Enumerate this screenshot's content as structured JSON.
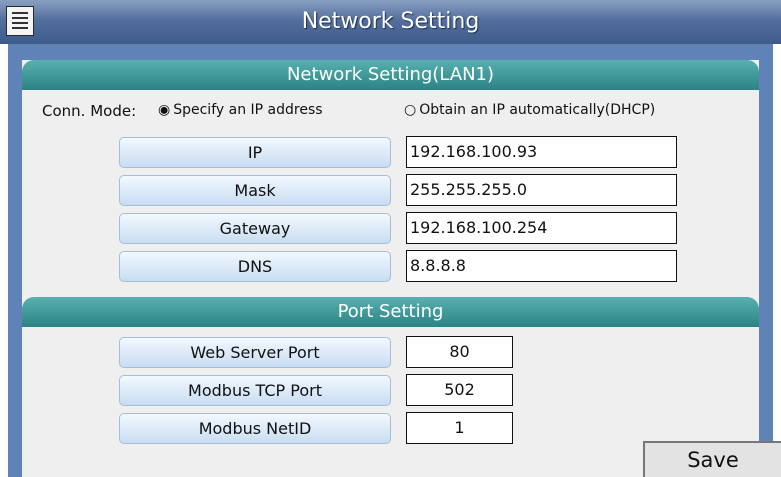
{
  "window": {
    "title": "Network Setting",
    "menu_icon": "menu-list-icon"
  },
  "lan_section": {
    "header": "Network Setting(LAN1)",
    "conn_mode_label": "Conn. Mode:",
    "options": [
      {
        "label": "Specify an IP address",
        "selected": true
      },
      {
        "label": "Obtain an IP automatically(DHCP)",
        "selected": false
      }
    ],
    "fields": [
      {
        "label": "IP",
        "value": "192.168.100.93"
      },
      {
        "label": "Mask",
        "value": "255.255.255.0"
      },
      {
        "label": "Gateway",
        "value": "192.168.100.254"
      },
      {
        "label": "DNS",
        "value": "8.8.8.8"
      }
    ]
  },
  "port_section": {
    "header": "Port Setting",
    "fields": [
      {
        "label": "Web Server Port",
        "value": "80"
      },
      {
        "label": "Modbus TCP Port",
        "value": "502"
      },
      {
        "label": "Modbus NetID",
        "value": "1"
      }
    ]
  },
  "save_label": "Save",
  "colors": {
    "title_bar": "#4a6696",
    "section_header": "#3f9898",
    "label_button": "#d9e8f7"
  }
}
